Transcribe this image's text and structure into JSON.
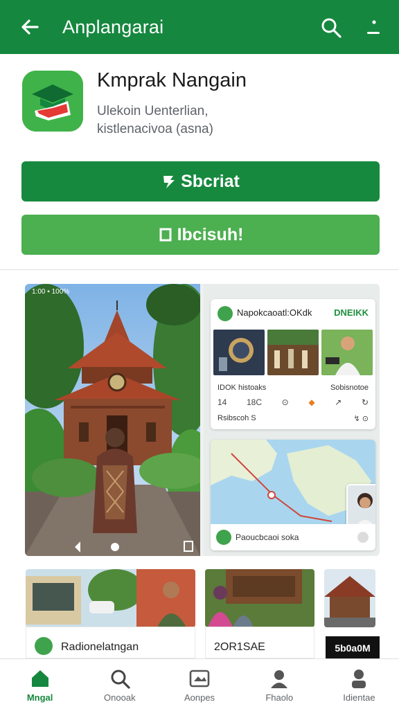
{
  "appbar": {
    "title": "Anplangarai",
    "back_icon": "arrow-left-icon",
    "search_icon": "search-icon",
    "more_icon": "more-vert-icon",
    "color": "#16873f"
  },
  "app": {
    "name": "Kmprak Nangain",
    "subtitle_line1": "Ulekoin Uenterlian,",
    "subtitle_line2": "kistlenacivoa (asna)",
    "icon": "app-logo-icon"
  },
  "buttons": {
    "primary_label": "Sbcriat",
    "secondary_label": "Ibcisuh!",
    "primary_color": "#17893f",
    "secondary_color": "#4caf50"
  },
  "screenshot": {
    "status_text": "1:00 ▪ 100%",
    "card1": {
      "title": "Napokcaoatl:OKdk",
      "action": "DNEIKK",
      "meta_left": "IDOK histoaks",
      "meta_right": "Sobisnotoe",
      "row_values": [
        "14",
        "18C",
        "⊙",
        "↗",
        "↻"
      ],
      "footer_left": "Rsibscoh S",
      "footer_right": "↯ ⊙"
    },
    "card2": {
      "label": "Paoucbcaoi soka"
    }
  },
  "strip": {
    "item1_label": "Radionelatngan",
    "item2_label": "2OR1SAE",
    "item3_badge": "5b0a0M"
  },
  "bottom_nav": {
    "items": [
      {
        "label": "Mngal",
        "icon": "home-icon",
        "active": true
      },
      {
        "label": "Onooak",
        "icon": "search-icon",
        "active": false
      },
      {
        "label": "Aonpes",
        "icon": "apps-icon",
        "active": false
      },
      {
        "label": "Fhaolo",
        "icon": "person-icon",
        "active": false
      },
      {
        "label": "Idientae",
        "icon": "account-icon",
        "active": false
      }
    ],
    "active_color": "#16873f"
  }
}
